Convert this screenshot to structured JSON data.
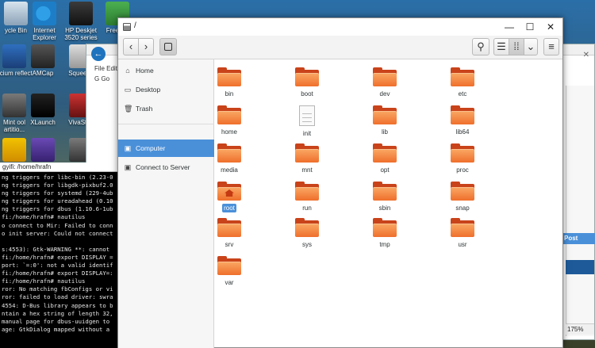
{
  "desktop": {
    "icons": [
      {
        "label": "ycle Bin"
      },
      {
        "label": "Internet Explorer"
      },
      {
        "label": "HP Deskjet 3520 series"
      },
      {
        "label": "Free Ed"
      },
      {
        "label": "acium reflect"
      },
      {
        "label": "AMCap"
      },
      {
        "label": "Squeeze"
      },
      {
        "label": "Mint ool artitio..."
      },
      {
        "label": "XLaunch"
      },
      {
        "label": "VivaStati"
      }
    ]
  },
  "browser": {
    "menu_text": "File  Edit",
    "bookmark_text": "G Go",
    "post_label": "Post",
    "zoom_label": "175%",
    "close_glyph": "✕",
    "back_glyph": "←"
  },
  "terminal": {
    "title": "gyifi: /home/hrafn",
    "lines": [
      "ng triggers for libc-bin (2.23-0",
      "ng triggers for libgdk-pixbuf2.0",
      "ng triggers for systemd (229-4ub",
      "ng triggers for ureadahead (0.10",
      "ng triggers for dbus (1.10.6-1ub",
      "fi:/home/hrafn# nautilus",
      "o connect to Mir: Failed to conn",
      "o init server: Could not connect",
      "",
      "s:4553): Gtk-WARNING **: cannot",
      "fi:/home/hrafn# export DISPLAY =",
      "port: `=:0': not a valid identif",
      "fi:/home/hrafn# export DISPLAY=:",
      "fi:/home/hrafn# nautilus",
      "ror: No matching fbConfigs or vi",
      "ror: failed to load driver: swra",
      "4554: D-Bus library appears to b",
      "ntain a hex string of length 32,",
      "manual page for dbus-uuidgen to",
      "age: GtkDialog mapped without a"
    ]
  },
  "files": {
    "title": "/",
    "window_buttons": {
      "minimize": "—",
      "maximize": "☐",
      "close": "✕"
    },
    "toolbar": {
      "back": "‹",
      "forward": "›",
      "search": "⚲",
      "list": "☰",
      "grid": "⁞⁞",
      "sort": "⌄",
      "menu": "≡"
    },
    "sidebar": [
      {
        "label": "Home",
        "icon": "home-icon",
        "glyph": "⌂"
      },
      {
        "label": "Desktop",
        "icon": "desktop-icon",
        "glyph": "▭"
      },
      {
        "label": "Trash",
        "icon": "trash-icon",
        "glyph": "🗑"
      },
      {
        "label": "Computer",
        "icon": "computer-icon",
        "glyph": "▣",
        "active": true
      },
      {
        "label": "Connect to Server",
        "icon": "server-icon",
        "glyph": "▣"
      }
    ],
    "items": [
      {
        "name": "bin",
        "type": "folder"
      },
      {
        "name": "boot",
        "type": "folder"
      },
      {
        "name": "dev",
        "type": "folder"
      },
      {
        "name": "etc",
        "type": "folder"
      },
      {
        "name": "home",
        "type": "folder"
      },
      {
        "name": "init",
        "type": "file"
      },
      {
        "name": "lib",
        "type": "folder"
      },
      {
        "name": "lib64",
        "type": "folder"
      },
      {
        "name": "media",
        "type": "folder"
      },
      {
        "name": "mnt",
        "type": "folder"
      },
      {
        "name": "opt",
        "type": "folder"
      },
      {
        "name": "proc",
        "type": "folder"
      },
      {
        "name": "root",
        "type": "home-folder",
        "selected": true
      },
      {
        "name": "run",
        "type": "folder"
      },
      {
        "name": "sbin",
        "type": "folder"
      },
      {
        "name": "snap",
        "type": "folder"
      },
      {
        "name": "srv",
        "type": "folder"
      },
      {
        "name": "sys",
        "type": "folder"
      },
      {
        "name": "tmp",
        "type": "folder"
      },
      {
        "name": "usr",
        "type": "folder"
      },
      {
        "name": "var",
        "type": "folder"
      }
    ]
  }
}
